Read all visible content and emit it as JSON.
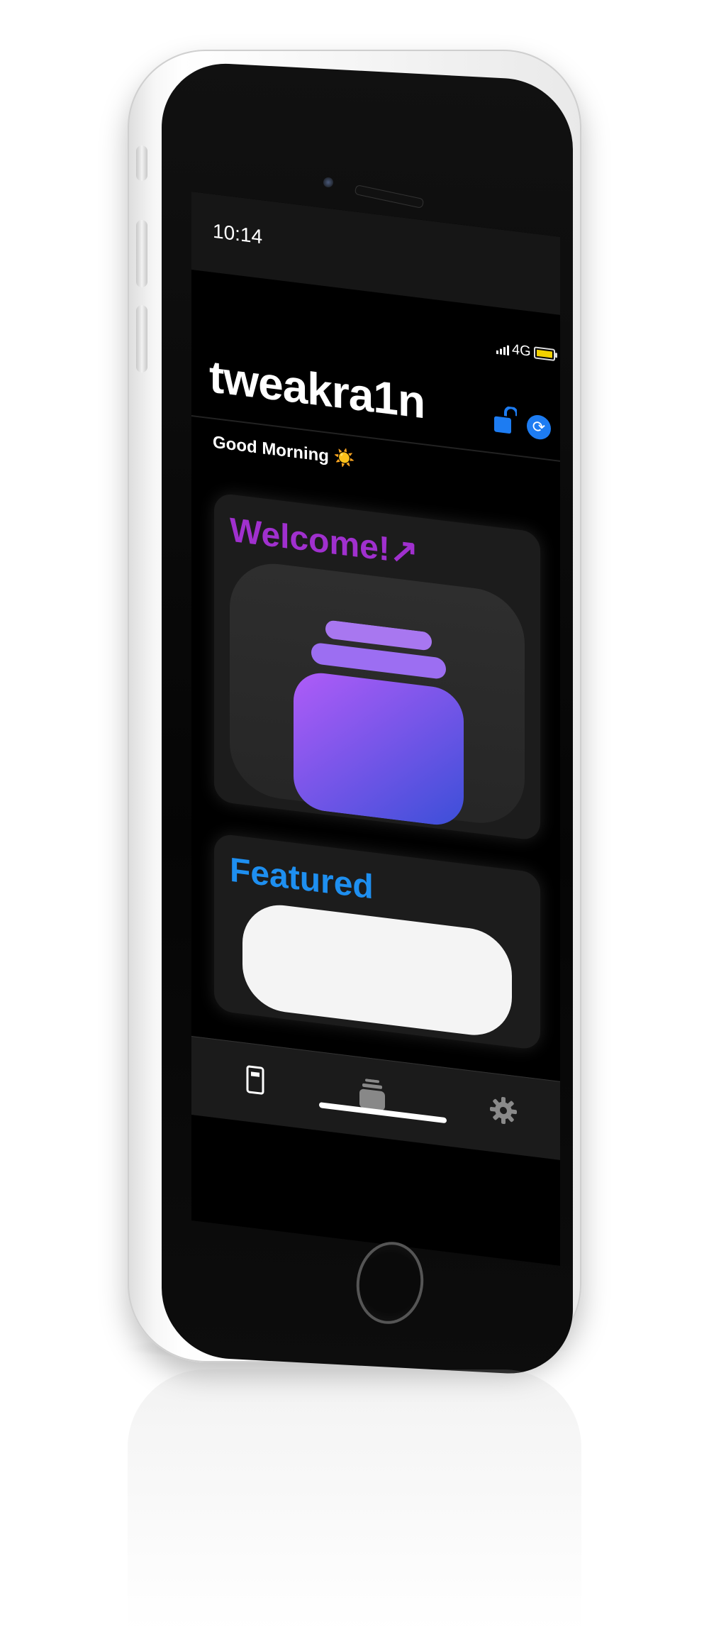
{
  "status_bar": {
    "time": "10:14",
    "network": "4G"
  },
  "header": {
    "app_title": "tweakra1n",
    "lock_icon": "unlocked-padlock",
    "refresh_icon": "circular-arrows"
  },
  "greeting": {
    "text": "Good Morning ☀️"
  },
  "cards": {
    "welcome": {
      "title": "Welcome!↗"
    },
    "featured": {
      "title": "Featured"
    }
  },
  "tab_bar": {
    "items": [
      {
        "icon": "phone-icon"
      },
      {
        "icon": "stack-icon"
      },
      {
        "icon": "gear-icon"
      }
    ]
  },
  "colors": {
    "accent_blue": "#1d7cf2",
    "welcome_purple": "#a030ce",
    "featured_blue": "#1e8ff0",
    "battery_yellow": "#f2d100",
    "stack_gradient_top": "#a855f7",
    "stack_gradient_bottom": "#3b4fd8"
  }
}
